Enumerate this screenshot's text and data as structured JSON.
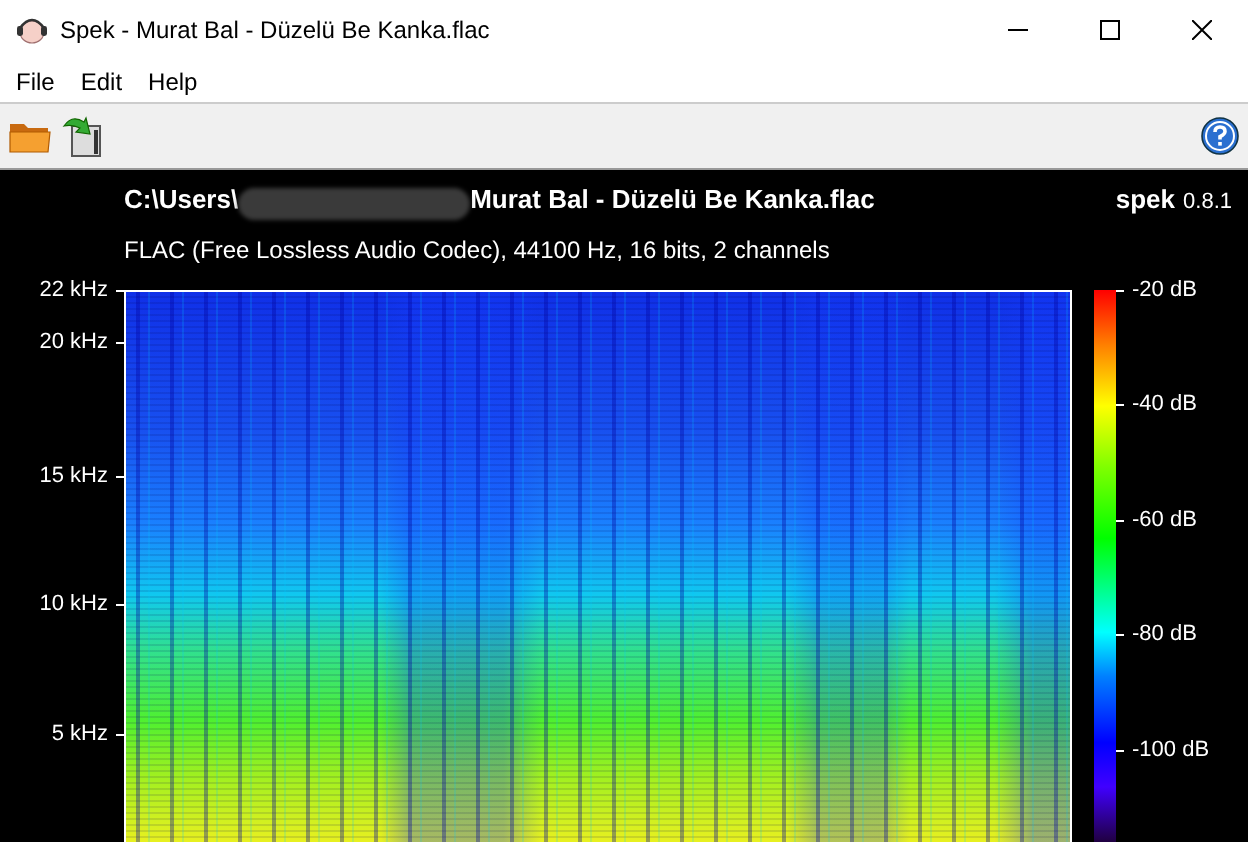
{
  "window": {
    "title": "Spek - Murat Bal - Düzelü Be Kanka.flac"
  },
  "menu": [
    "File",
    "Edit",
    "Help"
  ],
  "file": {
    "path_start": "C:\\Users\\",
    "path_end": "Murat Bal - Düzelü Be Kanka.flac",
    "info": "FLAC (Free Lossless Audio Codec), 44100 Hz, 16 bits, 2 channels"
  },
  "brand": {
    "name": "spek",
    "version": "0.8.1"
  },
  "frequency_axis": [
    "22 kHz",
    "20 kHz",
    "15 kHz",
    "10 kHz",
    "5 kHz"
  ],
  "level_axis": [
    "-20 dB",
    "-40 dB",
    "-60 dB",
    "-80 dB",
    "-100 dB"
  ]
}
